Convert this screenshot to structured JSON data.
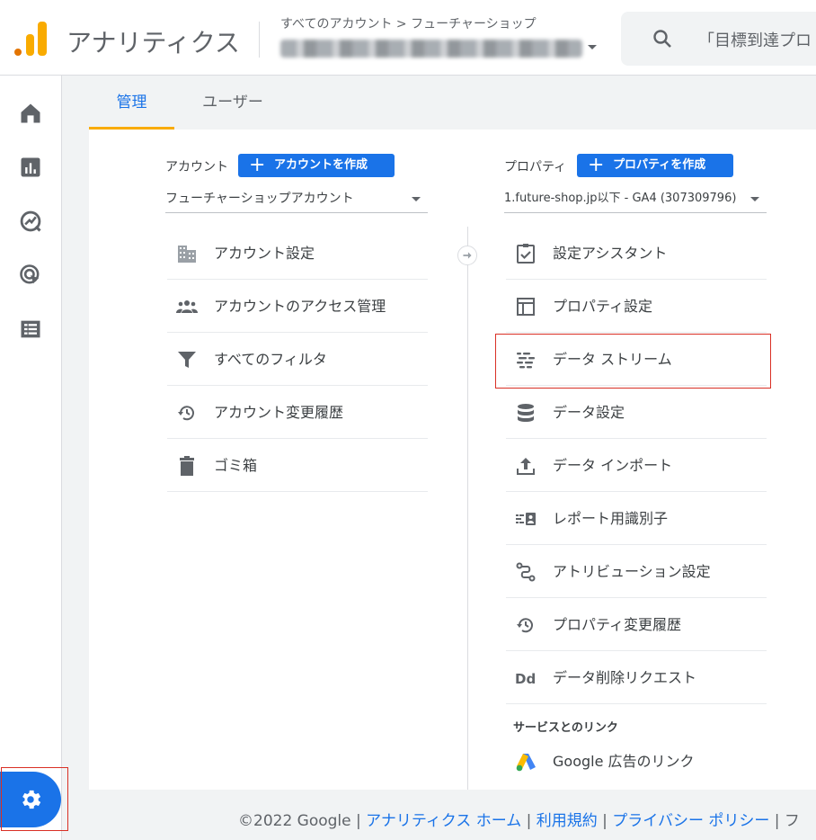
{
  "header": {
    "app_title": "アナリティクス",
    "breadcrumb": "すべてのアカウント > フューチャーショップ",
    "search_placeholder": "「目標到達プロ"
  },
  "tabs": [
    {
      "label": "管理"
    },
    {
      "label": "ユーザー"
    }
  ],
  "account": {
    "label": "アカウント",
    "create_button": "アカウントを作成",
    "selected": "フューチャーショップアカウント",
    "items": [
      {
        "label": "アカウント設定",
        "icon": "building-icon"
      },
      {
        "label": "アカウントのアクセス管理",
        "icon": "people-icon"
      },
      {
        "label": "すべてのフィルタ",
        "icon": "filter-icon"
      },
      {
        "label": "アカウント変更履歴",
        "icon": "history-icon"
      },
      {
        "label": "ゴミ箱",
        "icon": "trash-icon"
      }
    ]
  },
  "property": {
    "label": "プロパティ",
    "create_button": "プロパティを作成",
    "selected": "1.future-shop.jp以下 - GA4 (307309796)",
    "items": [
      {
        "label": "設定アシスタント",
        "icon": "checklist-icon"
      },
      {
        "label": "プロパティ設定",
        "icon": "layout-icon"
      },
      {
        "label": "データ ストリーム",
        "icon": "stream-icon"
      },
      {
        "label": "データ設定",
        "icon": "database-icon"
      },
      {
        "label": "データ インポート",
        "icon": "upload-icon"
      },
      {
        "label": "レポート用識別子",
        "icon": "identity-icon"
      },
      {
        "label": "アトリビューション設定",
        "icon": "attribution-icon"
      },
      {
        "label": "プロパティ変更履歴",
        "icon": "history-icon"
      },
      {
        "label": "データ削除リクエスト",
        "icon": "dd-icon"
      }
    ],
    "services_header": "サービスとのリンク",
    "services": [
      {
        "label": "Google 広告のリンク",
        "icon": "google-ads-icon"
      }
    ]
  },
  "sidebar": {
    "items": [
      "home-icon",
      "reports-icon",
      "explore-icon",
      "advertising-icon",
      "configure-icon"
    ],
    "admin": "gear-icon"
  },
  "footer": {
    "copyright": "©2022 Google",
    "links": [
      "アナリティクス ホーム",
      "利用規約",
      "プライバシー ポリシー"
    ],
    "trailing": "フ"
  },
  "colors": {
    "accent": "#1a73e8",
    "highlight": "#d93025",
    "tab_underline": "#f9ab00"
  }
}
